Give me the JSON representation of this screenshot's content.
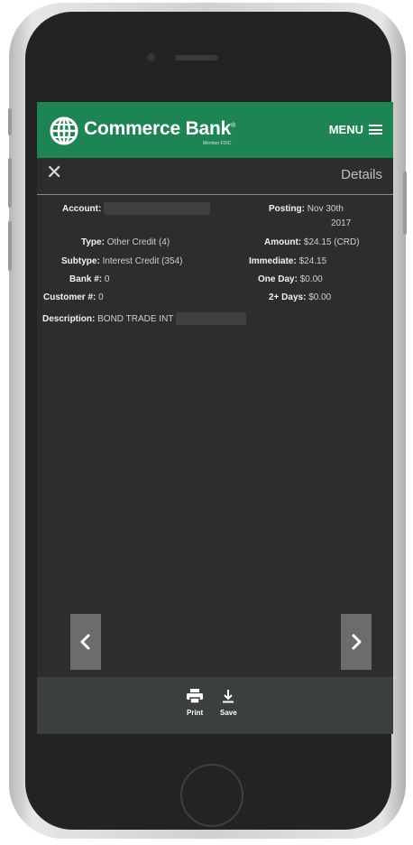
{
  "brand": {
    "name": "Commerce Bank",
    "trademark": "®",
    "sub_line": "Member FDIC"
  },
  "header": {
    "menu_label": "MENU",
    "menu_icon": "hamburger-icon"
  },
  "detail_bar": {
    "close_icon": "close-icon",
    "title": "Details"
  },
  "left_fields": [
    {
      "label": "Account:",
      "value": ""
    },
    {
      "label": "Type:",
      "value": "Other Credit (4)"
    },
    {
      "label": "Subtype:",
      "value": "Interest Credit (354)"
    },
    {
      "label": "Bank #:",
      "value": "0"
    },
    {
      "label": "Customer #:",
      "value": "0"
    },
    {
      "label": "Description:",
      "value": "BOND TRADE INT"
    }
  ],
  "right_fields": [
    {
      "label": "Posting:",
      "value": "Nov 30th",
      "value2": "2017"
    },
    {
      "label": "Amount:",
      "value": "$24.15 (CRD)"
    },
    {
      "label": "Immediate:",
      "value": "$24.15"
    },
    {
      "label": "One Day:",
      "value": "$0.00"
    },
    {
      "label": "2+ Days:",
      "value": "$0.00"
    }
  ],
  "navigation": {
    "prev_icon": "chevron-left-icon",
    "next_icon": "chevron-right-icon"
  },
  "toolbar": {
    "print_label": "Print",
    "print_icon": "printer-icon",
    "save_label": "Save",
    "save_icon": "download-icon"
  },
  "colors": {
    "brand_green": "#1f8454",
    "screen_bg": "#2d2d2d",
    "toolbar_bg": "#3b3f3f"
  }
}
